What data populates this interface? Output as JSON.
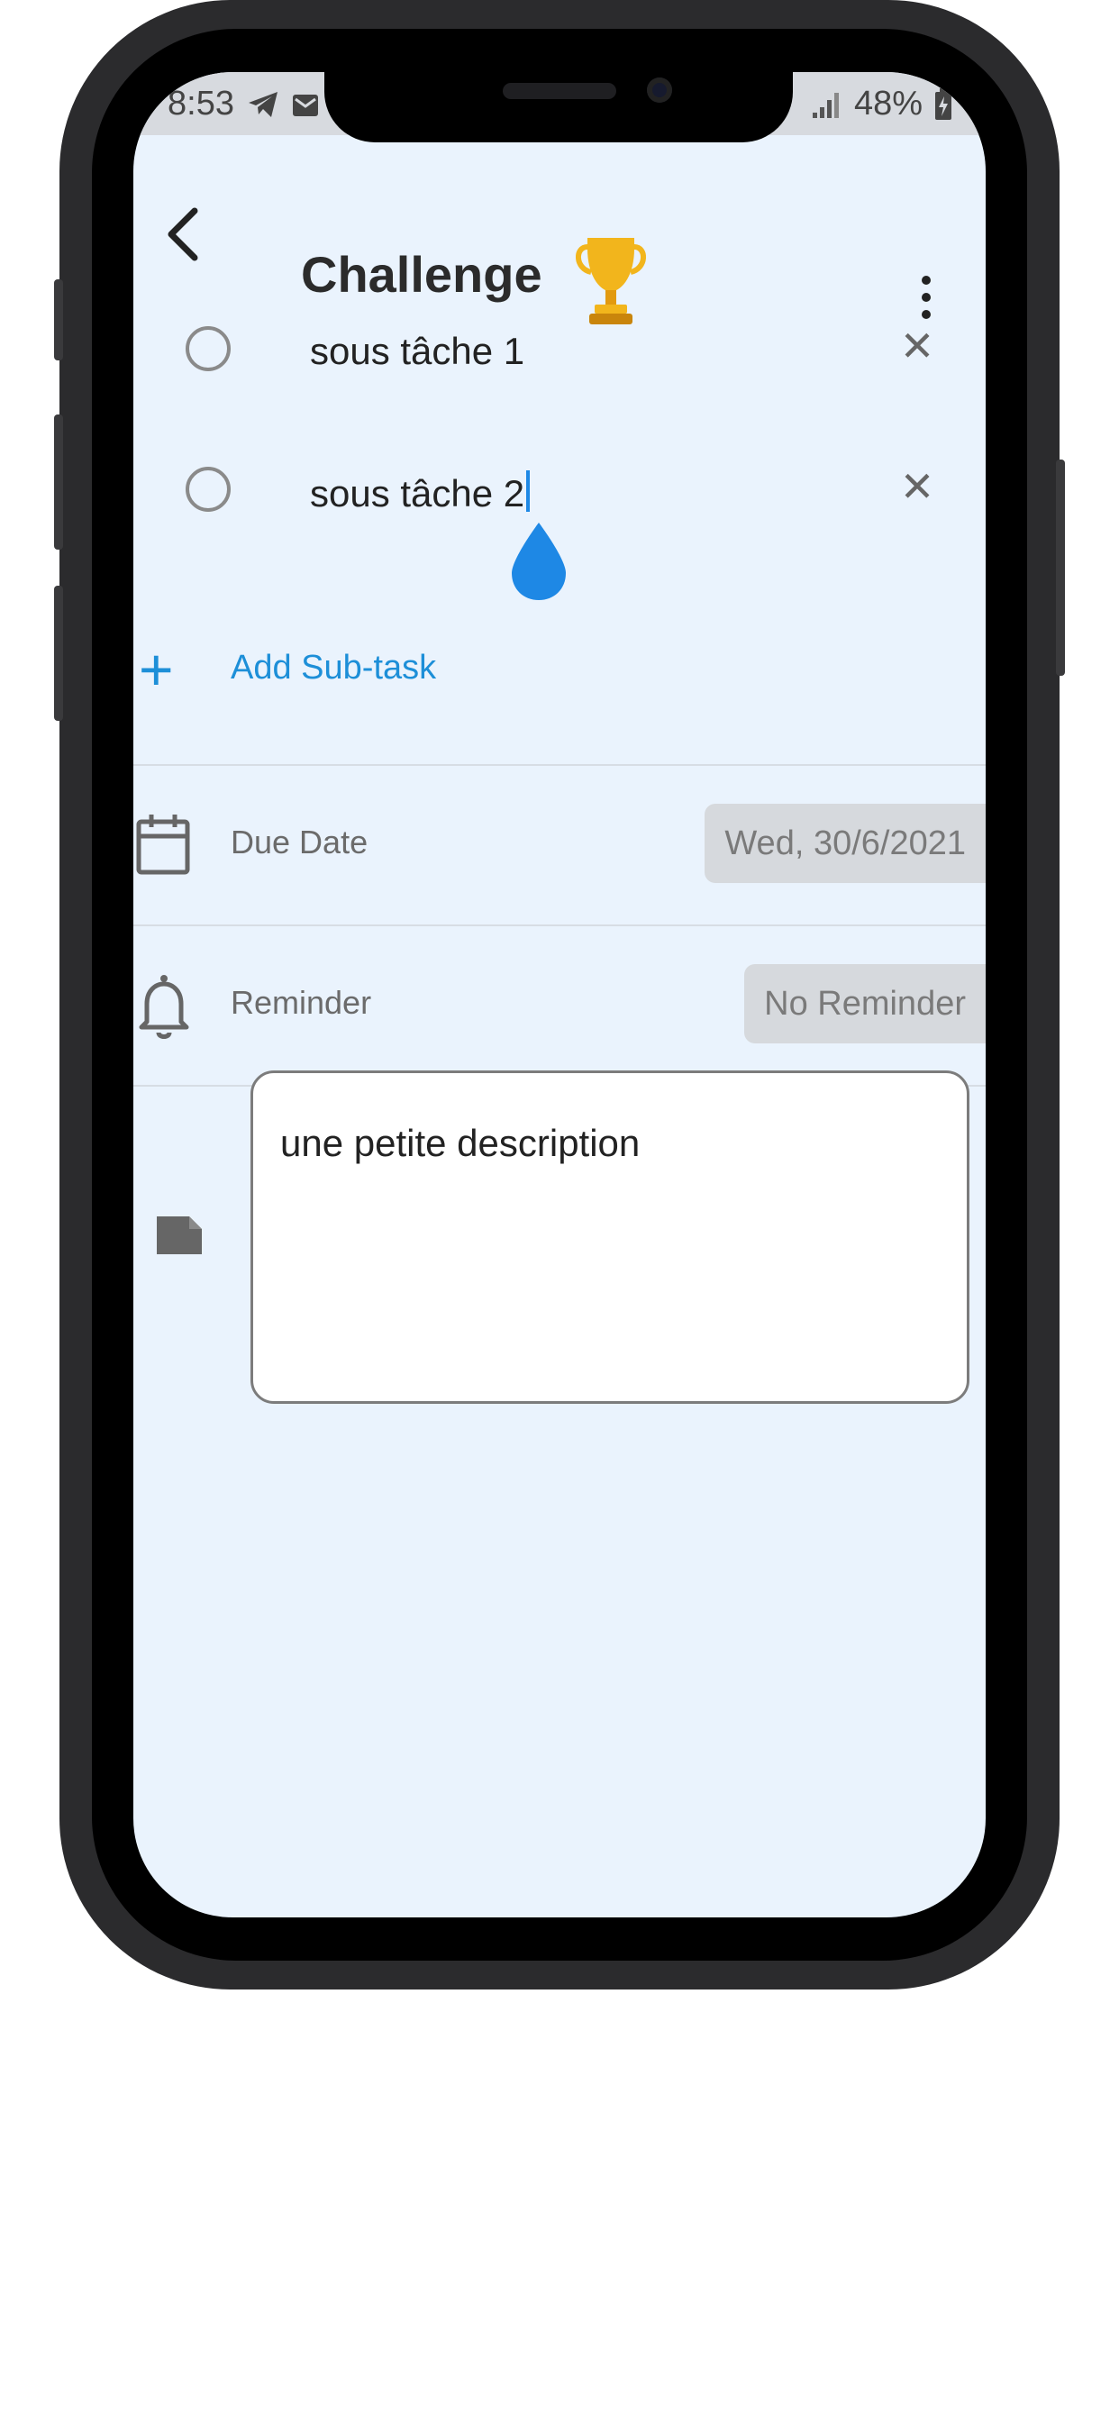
{
  "status_bar": {
    "time": "8:53",
    "battery": "48%"
  },
  "header": {
    "title": "Challenge"
  },
  "subtasks": [
    {
      "label": "sous tâche 1"
    },
    {
      "label": "sous tâche 2"
    }
  ],
  "add_subtask": {
    "label": "Add Sub-task"
  },
  "due_date": {
    "label": "Due Date",
    "value": "Wed, 30/6/2021"
  },
  "reminder": {
    "label": "Reminder",
    "value": "No Reminder"
  },
  "description": {
    "value": "une petite description"
  },
  "colors": {
    "accent": "#1d8fd8",
    "screen_background": "#eaf3fd",
    "chip_background": "#d6d9dd",
    "trophy": "#f2b51c"
  },
  "icons": [
    "back-arrow-icon",
    "trophy-icon",
    "more-vert-icon",
    "circle-checkbox-icon",
    "close-icon",
    "plus-icon",
    "calendar-icon",
    "bell-icon",
    "note-icon",
    "telegram-icon",
    "mail-icon",
    "signal-icon",
    "battery-icon"
  ]
}
